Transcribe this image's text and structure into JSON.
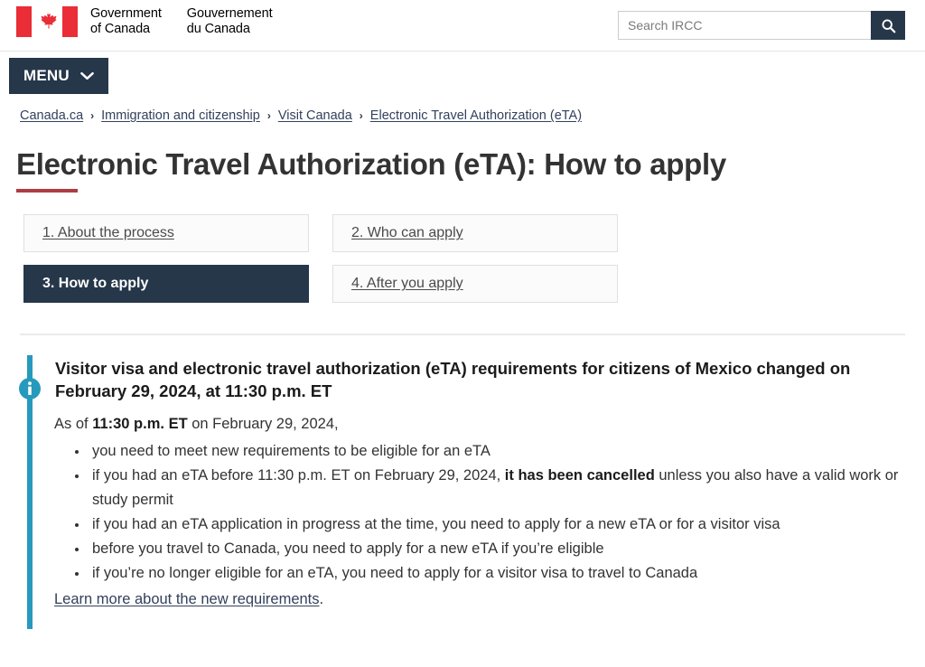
{
  "header": {
    "flag_icon": "canada-flag-icon",
    "wordmark_en_line1": "Government",
    "wordmark_en_line2": "of Canada",
    "wordmark_fr_line1": "Gouvernement",
    "wordmark_fr_line2": "du Canada",
    "search_placeholder": "Search IRCC",
    "search_value": "",
    "search_icon": "search-icon",
    "search_button_color": "#26374a"
  },
  "menu": {
    "label": "MENU",
    "chevron_icon": "chevron-down-icon",
    "background_color": "#26374a"
  },
  "breadcrumb": {
    "items": [
      {
        "label": "Canada.ca"
      },
      {
        "label": "Immigration and citizenship"
      },
      {
        "label": "Visit Canada"
      },
      {
        "label": "Electronic Travel Authorization (eTA)"
      }
    ],
    "separator": "›"
  },
  "page": {
    "title": "Electronic Travel Authorization (eTA): How to apply",
    "title_rule_color": "#af3c43"
  },
  "steps": [
    {
      "label": "1. About the process",
      "active": false
    },
    {
      "label": "2. Who can apply",
      "active": false
    },
    {
      "label": "3. How to apply",
      "active": true
    },
    {
      "label": "4. After you apply",
      "active": false
    }
  ],
  "callout": {
    "type": "info",
    "icon": "info-circle-icon",
    "accent_color": "#269abc",
    "title": "Visitor visa and electronic travel authorization (eTA) requirements for citizens of Mexico changed on February 29, 2024, at 11:30 p.m. ET",
    "intro_prefix": "As of ",
    "intro_bold": "11:30 p.m. ET",
    "intro_suffix": " on February 29, 2024,",
    "bullets": [
      {
        "text": "you need to meet new requirements to be eligible for an eTA"
      },
      {
        "prefix": "if you had an eTA before 11:30 p.m. ET on February 29, 2024, ",
        "bold": "it has been cancelled",
        "suffix": " unless you also have a valid work or study permit"
      },
      {
        "text": "if you had an eTA application in progress at the time, you need to apply for a new eTA or for a visitor visa"
      },
      {
        "text": "before you travel to Canada, you need to apply for a new eTA if you’re eligible"
      },
      {
        "text": "if you’re no longer eligible for an eTA, you need to apply for a visitor visa to travel to Canada"
      }
    ],
    "link_text": "Learn more about the new requirements",
    "link_period": "."
  }
}
